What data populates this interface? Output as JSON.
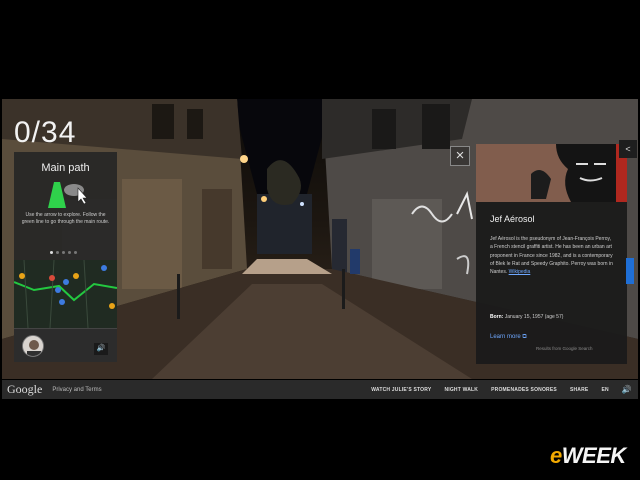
{
  "counter": "0/34",
  "path_panel": {
    "title": "Main path",
    "close": "×",
    "description": "Use the arrow to explore. Follow the green line to go through the main route.",
    "dots_count": 5,
    "active_dot": 0,
    "speaker": "🔊"
  },
  "scene": {
    "close": "×"
  },
  "info_panel": {
    "name": "Jef Aérosol",
    "description": "Jef Aérosol is the pseudonym of Jean-François Perroy, a French stencil graffiti artist. He has been an urban art proponent in France since 1982, and is a contemporary of Blek le Rat and Speedy Graphito. Perroy was born in Nantes.",
    "wiki_link": "Wikipedia",
    "born_label": "Born:",
    "born_value": "January 15, 1957 (age 57)",
    "learn_more": "Learn more ⧉",
    "source": "Results from Google Search"
  },
  "share": "<",
  "footer": {
    "logo": "Google",
    "privacy": "Privacy and Terms",
    "nav": [
      "WATCH JULIE'S STORY",
      "NIGHT WALK",
      "PROMENADES SONORES",
      "SHARE",
      "EN"
    ],
    "volume": "🔊"
  },
  "watermark": {
    "e": "e",
    "rest": "WEEK"
  },
  "colors": {
    "accent_blue": "#6ea8ff",
    "route_green": "#23c840",
    "brand_orange": "#f2a900"
  }
}
